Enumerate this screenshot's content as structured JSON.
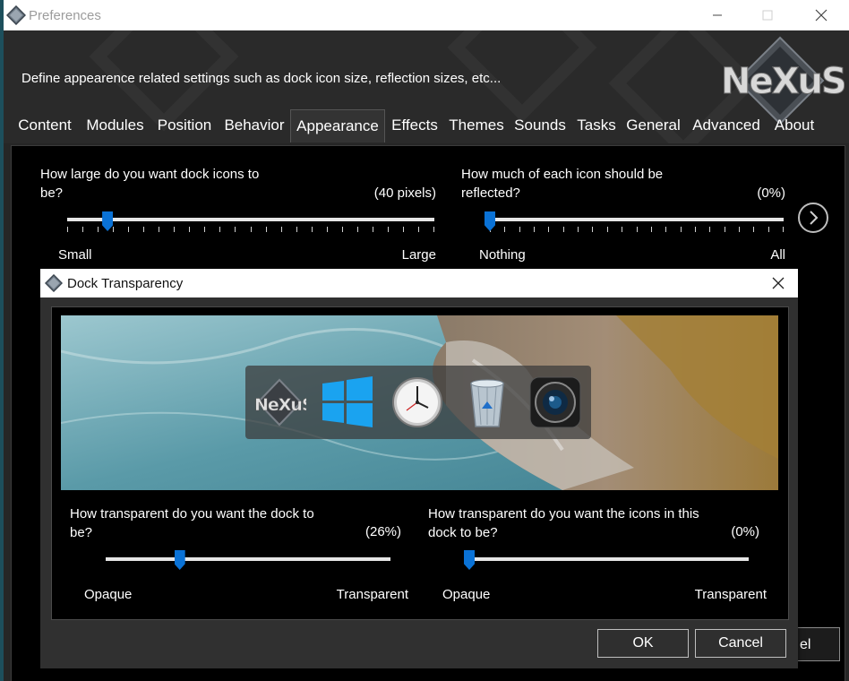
{
  "window": {
    "title": "Preferences",
    "description": "Define appearence related settings such as dock icon size, reflection sizes, etc..."
  },
  "tabs": [
    {
      "label": "Content"
    },
    {
      "label": "Modules"
    },
    {
      "label": "Position"
    },
    {
      "label": "Behavior"
    },
    {
      "label": "Appearance",
      "active": true
    },
    {
      "label": "Effects"
    },
    {
      "label": "Themes"
    },
    {
      "label": "Sounds"
    },
    {
      "label": "Tasks"
    },
    {
      "label": "General"
    },
    {
      "label": "Advanced"
    },
    {
      "label": "About"
    }
  ],
  "appearance": {
    "icon_size": {
      "question": "How large do you want dock icons to be?",
      "value": "(40 pixels)",
      "min_label": "Small",
      "max_label": "Large",
      "level": 0.11
    },
    "reflection": {
      "question": "How much of each icon should be reflected?",
      "value": "(0%)",
      "min_label": "Nothing",
      "max_label": "All",
      "level": 0.0
    }
  },
  "background_buttons": {
    "cancel_partial": "el"
  },
  "dialog": {
    "title": "Dock Transparency",
    "dock_icons": [
      "nexus-logo-icon",
      "windows-logo-icon",
      "clock-icon",
      "recycle-bin-icon",
      "camera-icon"
    ],
    "dock_transparency": {
      "question": "How transparent do you want the dock to be?",
      "value": "(26%)",
      "min_label": "Opaque",
      "max_label": "Transparent",
      "level": 0.26
    },
    "icon_transparency": {
      "question": "How transparent do you want the icons in this dock to be?",
      "value": "(0%)",
      "min_label": "Opaque",
      "max_label": "Transparent",
      "level": 0.0
    },
    "ok_label": "OK",
    "cancel_label": "Cancel"
  },
  "colors": {
    "accent": "#0a72d6",
    "background": "#000000",
    "panel": "#262626"
  }
}
